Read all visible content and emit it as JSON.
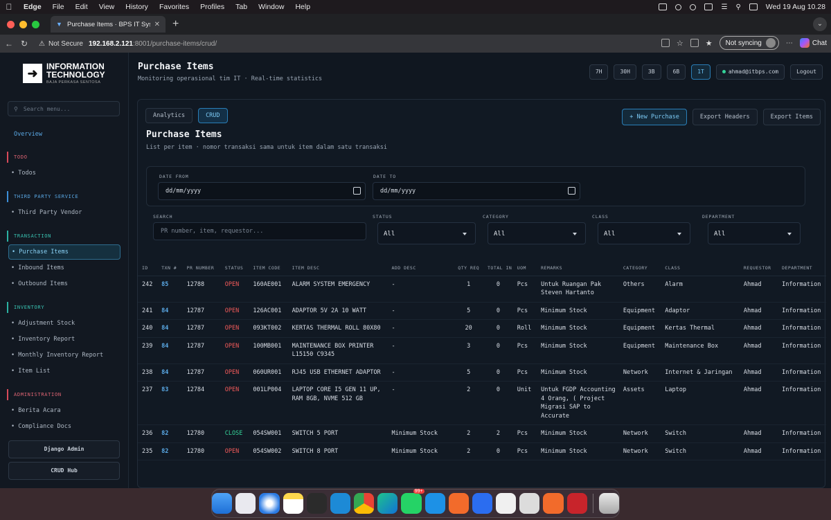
{
  "menubar": {
    "app_name": "Edge",
    "items": [
      "File",
      "Edit",
      "View",
      "History",
      "Favorites",
      "Profiles",
      "Tab",
      "Window",
      "Help"
    ],
    "clock": "Wed 19 Aug 10.28"
  },
  "browser": {
    "tab_title": "Purchase Items · BPS IT System",
    "not_secure": "Not Secure",
    "host": "192.168.2.121",
    "path": ":8001/purchase-items/crud/",
    "sync_label": "Not syncing",
    "chat_label": "Chat"
  },
  "sidebar": {
    "logo_line1": "INFORMATION",
    "logo_line2": "TECHNOLOGY",
    "logo_line3": "BAJA PERKASA SENTOSA",
    "search_placeholder": "Search menu...",
    "overview": "Overview",
    "sections": [
      {
        "title": "TODO",
        "items": [
          "Todos"
        ]
      },
      {
        "title": "THIRD PARTY SERVICE",
        "items": [
          "Third Party Vendor"
        ]
      },
      {
        "title": "TRANSACTION",
        "items": [
          "Purchase Items",
          "Inbound Items",
          "Outbound Items"
        ]
      },
      {
        "title": "INVENTORY",
        "items": [
          "Adjustment Stock",
          "Inventory Report",
          "Monthly Inventory Report",
          "Item List"
        ]
      },
      {
        "title": "ADMINISTRATION",
        "items": [
          "Berita Acara",
          "Compliance Docs"
        ]
      }
    ],
    "django_admin": "Django Admin",
    "crud_hub": "CRUD Hub"
  },
  "header": {
    "title": "Purchase Items",
    "subtitle": "Monitoring operasional tim IT · Real-time statistics",
    "ranges": [
      "7H",
      "30H",
      "3B",
      "6B",
      "1T"
    ],
    "active_range": "1T",
    "user": "ahmad@itbps.com",
    "logout": "Logout"
  },
  "card": {
    "tabs": [
      "Analytics",
      "CRUD"
    ],
    "active_tab": "CRUD",
    "title": "Purchase Items",
    "subtitle": "List per item · nomor transaksi sama untuk item dalam satu transaksi",
    "new_purchase": "+ New Purchase",
    "export_headers": "Export Headers",
    "export_items": "Export Items"
  },
  "filters": {
    "date_from_label": "DATE FROM",
    "date_from_placeholder": "dd/mm/yyyy",
    "date_to_label": "DATE TO",
    "date_to_placeholder": "dd/mm/yyyy",
    "search_label": "SEARCH",
    "search_placeholder": "PR number, item, requestor...",
    "status_label": "STATUS",
    "status_value": "All",
    "category_label": "CATEGORY",
    "category_value": "All",
    "class_label": "CLASS",
    "class_value": "All",
    "department_label": "DEPARTMENT",
    "department_value": "All"
  },
  "table": {
    "columns": [
      "ID",
      "TXN #",
      "PR NUMBER",
      "STATUS",
      "ITEM CODE",
      "ITEM DESC",
      "ADD DESC",
      "QTY REQ",
      "TOTAL IN",
      "UOM",
      "REMARKS",
      "CATEGORY",
      "CLASS",
      "REQUESTOR",
      "DEPARTMENT"
    ],
    "rows": [
      [
        "242",
        "85",
        "12788",
        "OPEN",
        "160AE001",
        "ALARM SYSTEM EMERGENCY",
        "-",
        "1",
        "0",
        "Pcs",
        "Untuk Ruangan Pak Steven Hartanto",
        "Others",
        "Alarm",
        "Ahmad",
        "Information"
      ],
      [
        "241",
        "84",
        "12787",
        "OPEN",
        "126AC001",
        "ADAPTOR 5V 2A 10 WATT",
        "-",
        "5",
        "0",
        "Pcs",
        "Minimum Stock",
        "Equipment",
        "Adaptor",
        "Ahmad",
        "Information"
      ],
      [
        "240",
        "84",
        "12787",
        "OPEN",
        "093KT002",
        "KERTAS THERMAL ROLL 80X80",
        "-",
        "20",
        "0",
        "Roll",
        "Minimum Stock",
        "Equipment",
        "Kertas Thermal",
        "Ahmad",
        "Information"
      ],
      [
        "239",
        "84",
        "12787",
        "OPEN",
        "100MB001",
        "MAINTENANCE BOX PRINTER L15150 C9345",
        "-",
        "3",
        "0",
        "Pcs",
        "Minimum Stock",
        "Equipment",
        "Maintenance Box",
        "Ahmad",
        "Information"
      ],
      [
        "238",
        "84",
        "12787",
        "OPEN",
        "060UR001",
        "RJ45 USB ETHERNET ADAPTOR",
        "-",
        "5",
        "0",
        "Pcs",
        "Minimum Stock",
        "Network",
        "Internet & Jaringan",
        "Ahmad",
        "Information"
      ],
      [
        "237",
        "83",
        "12784",
        "OPEN",
        "001LP004",
        "LAPTOP CORE I5 GEN 11 UP, RAM 8GB, NVME 512 GB",
        "-",
        "2",
        "0",
        "Unit",
        "Untuk FGDP Accounting 4 Orang, ( Project Migrasi SAP to Accurate",
        "Assets",
        "Laptop",
        "Ahmad",
        "Information"
      ],
      [
        "236",
        "82",
        "12780",
        "CLOSE",
        "054SW001",
        "SWITCH 5 PORT",
        "Minimum Stock",
        "2",
        "2",
        "Pcs",
        "Minimum Stock",
        "Network",
        "Switch",
        "Ahmad",
        "Information"
      ],
      [
        "235",
        "82",
        "12780",
        "OPEN",
        "054SW002",
        "SWITCH 8 PORT",
        "Minimum Stock",
        "2",
        "0",
        "Pcs",
        "Minimum Stock",
        "Network",
        "Switch",
        "Ahmad",
        "Information"
      ]
    ]
  },
  "dock": {
    "badge": "99+",
    "icons": [
      "finder-icon",
      "launchpad-icon",
      "safari-icon",
      "notes-icon",
      "terminal-icon",
      "vscode-icon",
      "chrome-icon",
      "edge-icon",
      "whatsapp-icon",
      "docker-icon",
      "pen-icon",
      "app-icon",
      "preview-icon",
      "h-app-icon",
      "postman-icon",
      "sec-icon",
      "trash-icon"
    ]
  },
  "colors": {
    "accent": "#5aa9e6",
    "open": "#f25a5a",
    "close": "#34d399",
    "section_red": "#e06574"
  }
}
